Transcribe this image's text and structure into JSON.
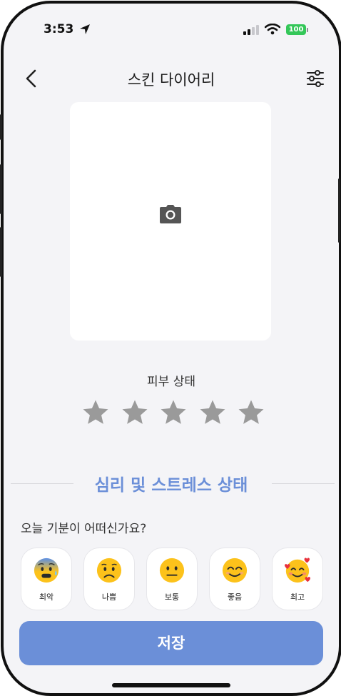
{
  "status_bar": {
    "time": "3:53",
    "battery": "100"
  },
  "nav": {
    "title": "스킨 다이어리"
  },
  "rating": {
    "label": "피부 상태",
    "max_stars": 5,
    "value": 0
  },
  "stress": {
    "section_title": "심리 및 스트레스 상태",
    "question": "오늘 기분이 어떠신가요?",
    "moods": [
      {
        "label": "최악",
        "icon": "anxious-sweat-face-icon"
      },
      {
        "label": "나쁨",
        "icon": "worried-face-icon"
      },
      {
        "label": "보통",
        "icon": "neutral-face-icon"
      },
      {
        "label": "좋음",
        "icon": "smiling-face-icon"
      },
      {
        "label": "최고",
        "icon": "smiling-face-with-hearts-icon"
      }
    ]
  },
  "actions": {
    "save_label": "저장"
  },
  "colors": {
    "accent": "#6b8fd8",
    "star_inactive": "#9a9a9a",
    "battery": "#34c759"
  }
}
